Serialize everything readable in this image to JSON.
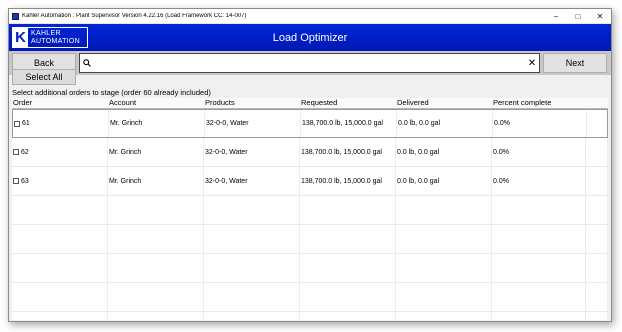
{
  "window": {
    "title": "Kahler Automation : Plant Supervisor Version 4.22.16 (Load Framework CC: 14-007)",
    "controls": {
      "minimize": "–",
      "maximize": "□",
      "close": "✕"
    }
  },
  "header": {
    "title": "Load Optimizer",
    "logo_letter": "K",
    "logo_line1": "KAHLER",
    "logo_line2": "AUTOMATION"
  },
  "toolbar": {
    "back_label": "Back",
    "next_label": "Next",
    "search_value": "",
    "clear_glyph": "✕"
  },
  "select_all_label": "Select All",
  "info_text": "Select additional orders to stage (order 60 already included)",
  "table": {
    "columns": [
      "Order",
      "Account",
      "Products",
      "Requested",
      "Delivered",
      "Percent complete"
    ],
    "rows": [
      {
        "order": "61",
        "account": "Mr. Grinch",
        "products": "32-0-0, Water",
        "requested": "138,700.0 lb, 15,000.0 gal",
        "delivered": "0.0 lb, 0.0 gal",
        "percent": "0.0%"
      },
      {
        "order": "62",
        "account": "Mr. Grinch",
        "products": "32-0-0, Water",
        "requested": "138,700.0 lb, 15,000.0 gal",
        "delivered": "0.0 lb, 0.0 gal",
        "percent": "0.0%"
      },
      {
        "order": "63",
        "account": "Mr. Grinch",
        "products": "32-0-0, Water",
        "requested": "138,700.0 lb, 15,000.0 gal",
        "delivered": "0.0 lb, 0.0 gal",
        "percent": "0.0%"
      }
    ]
  },
  "colors": {
    "header_blue": "#0020c8",
    "toolbar_gray": "#c8c8c8"
  },
  "icons": {
    "app": "kahler-app-icon",
    "search": "search-icon",
    "clear": "close-icon"
  }
}
